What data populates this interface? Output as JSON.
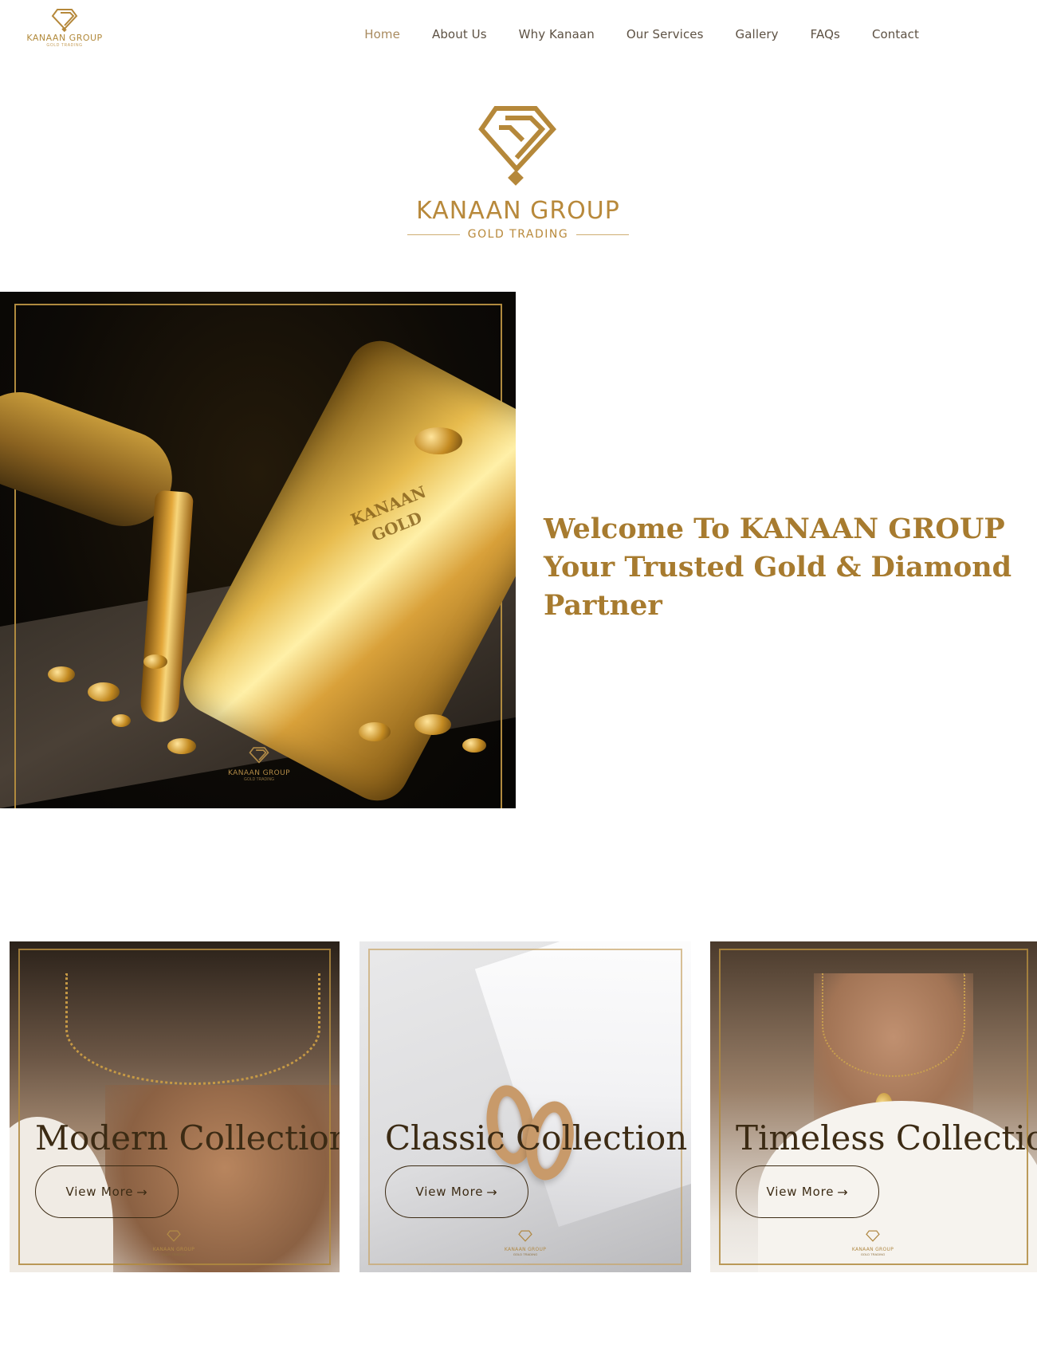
{
  "brand": {
    "name": "KANAAN GROUP",
    "tagline": "GOLD TRADING",
    "color": "#b5883a"
  },
  "nav": {
    "items": [
      {
        "label": "Home",
        "active": true
      },
      {
        "label": "About Us"
      },
      {
        "label": "Why Kanaan"
      },
      {
        "label": "Our Services"
      },
      {
        "label": "Gallery"
      },
      {
        "label": "FAQs"
      },
      {
        "label": "Contact"
      }
    ]
  },
  "hero": {
    "logo_name": "KANAAN GROUP",
    "logo_tagline": "GOLD TRADING",
    "image_icon": "gold-bar-pour-image",
    "bar_stamp": "KANAAN GOLD",
    "watermark_name": "KANAAN GROUP",
    "watermark_sub": "GOLD TRADING",
    "welcome": "Welcome To KANAAN GROUP Your Trusted Gold & Diamond Partner"
  },
  "collections": {
    "items": [
      {
        "title": "Modern Collection",
        "button": "View More",
        "arrow": "→",
        "image_icon": "necklace-chain-image"
      },
      {
        "title": "Classic Collection",
        "button": "View More",
        "arrow": "→",
        "image_icon": "hoop-earrings-image"
      },
      {
        "title": "Timeless Collection",
        "button": "View More",
        "arrow": "→",
        "image_icon": "pendant-necklace-image"
      }
    ],
    "watermark_name": "KANAAN GROUP",
    "watermark_sub": "GOLD TRADING"
  },
  "colors": {
    "accent_gold": "#a77b2f",
    "nav_text": "#5d5143",
    "card_text": "#3c2b14"
  }
}
